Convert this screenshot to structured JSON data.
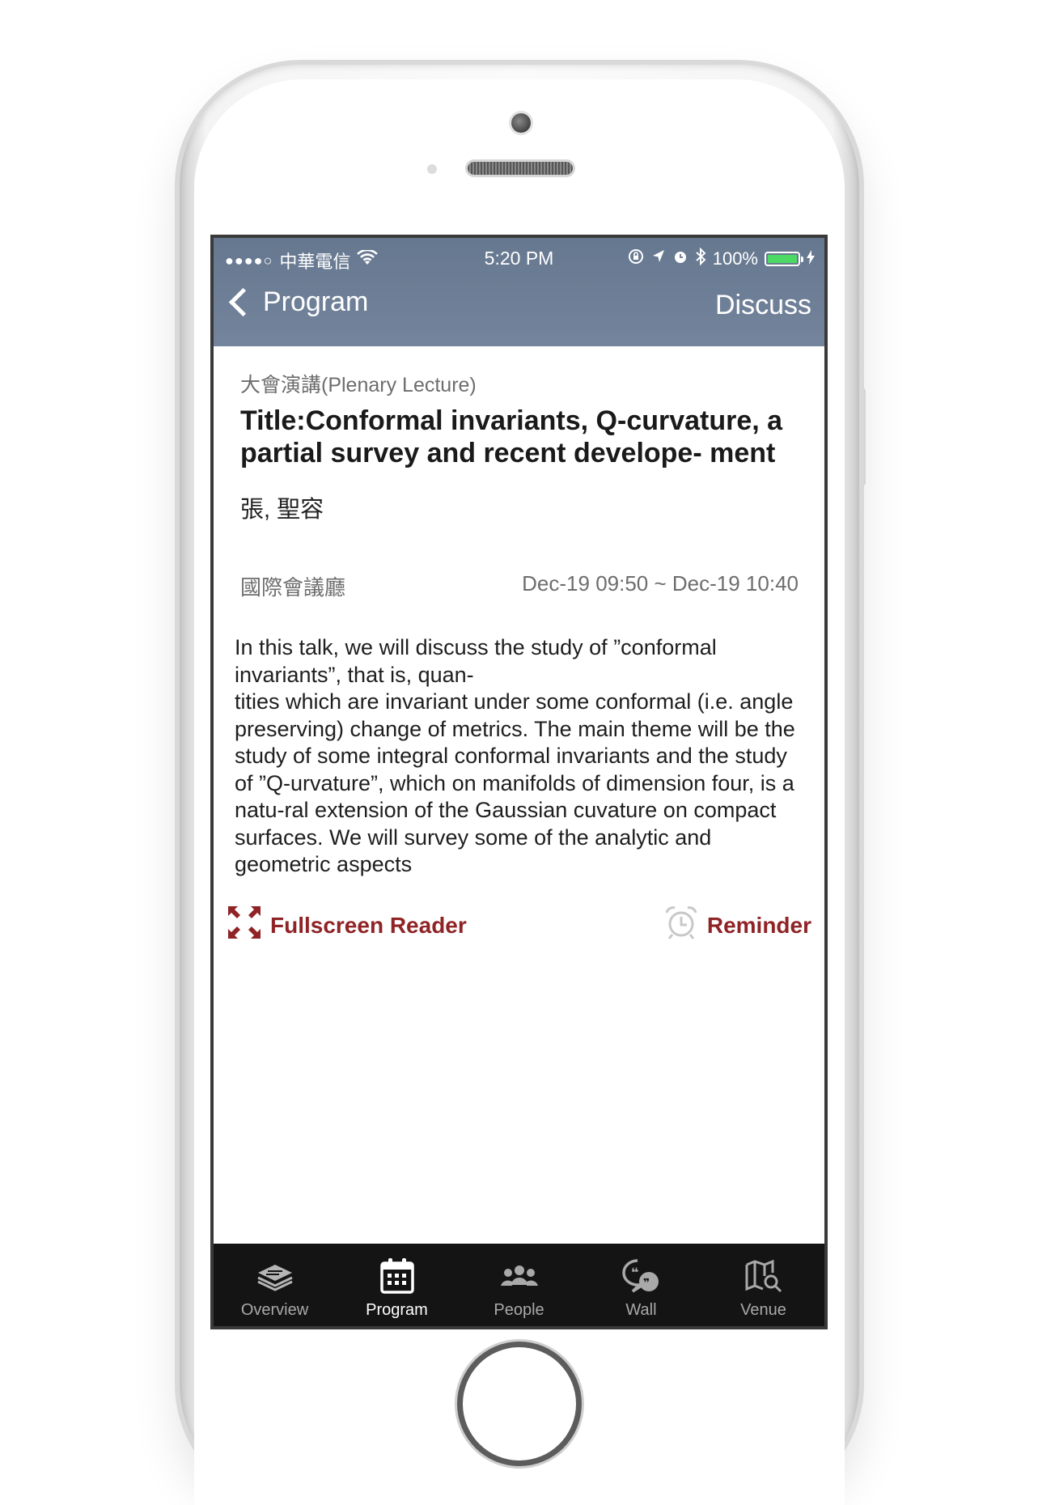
{
  "status_bar": {
    "signal": "●●●●○",
    "carrier": "中華電信",
    "time": "5:20 PM",
    "battery": "100%",
    "battery_level": 1.0
  },
  "nav": {
    "back_label": "Program",
    "action_label": "Discuss"
  },
  "session": {
    "category": "大會演講(Plenary Lecture)",
    "title": "Title:Conformal invariants, Q-curvature, a partial survey and recent develope- ment",
    "speaker": "張, 聖容",
    "venue": "國際會議廳",
    "time": "Dec-19 09:50 ~ Dec-19 10:40",
    "abstract": "In this talk, we will discuss the study of ”conformal invariants”, that is, quan-\ntities which are invariant under some conformal (i.e. angle preserving) change of metrics. The main theme will be the study of some integral conformal invariants and the study of ”Q-urvature”, which on manifolds of dimension four, is a natu-ral extension of the Gaussian cuvature on compact surfaces. We will survey some of the analytic and  geometric aspects"
  },
  "actions": {
    "fullscreen_label": "Fullscreen Reader",
    "reminder_label": "Reminder"
  },
  "tabs": [
    {
      "label": "Overview",
      "icon": "layers-icon",
      "active": false
    },
    {
      "label": "Program",
      "icon": "calendar-icon",
      "active": true
    },
    {
      "label": "People",
      "icon": "people-icon",
      "active": false
    },
    {
      "label": "Wall",
      "icon": "chat-icon",
      "active": false
    },
    {
      "label": "Venue",
      "icon": "map-search-icon",
      "active": false
    }
  ],
  "colors": {
    "nav_bar": "#6e8098",
    "accent": "#8f2326",
    "tab_bar": "#141414",
    "battery_fill": "#4cd964"
  }
}
